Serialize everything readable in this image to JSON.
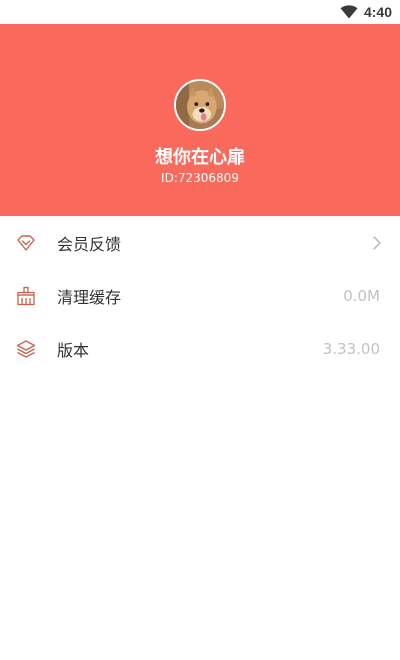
{
  "status_bar": {
    "time": "4:40",
    "wifi_icon": "wifi-icon"
  },
  "profile": {
    "username": "想你在心扉",
    "user_id": "ID:72306809",
    "background_color": "#F96A5C",
    "avatar_icon": "avatar-dog-photo"
  },
  "menu": {
    "items": [
      {
        "label": "会员反馈",
        "icon": "diamond-icon",
        "trailing": "chevron-right-icon",
        "value": ""
      },
      {
        "label": "清理缓存",
        "icon": "broom-icon",
        "trailing": "",
        "value": "0.0M"
      },
      {
        "label": "版本",
        "icon": "layers-icon",
        "trailing": "",
        "value": "3.33.00"
      }
    ],
    "icon_color": "#C9624F"
  }
}
